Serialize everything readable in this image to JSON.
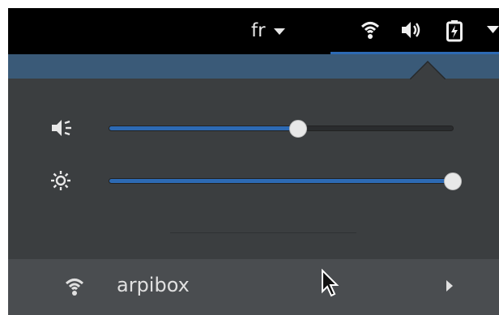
{
  "topbar": {
    "language": "fr",
    "icons": [
      "chevron-down-icon",
      "wifi-icon",
      "volume-icon",
      "battery-charging-icon",
      "chevron-down-icon"
    ]
  },
  "sliders": {
    "volume": {
      "icon": "volume-icon",
      "level": 0.55
    },
    "brightness": {
      "icon": "brightness-icon",
      "level": 1.0
    }
  },
  "network": {
    "icon": "wifi-icon",
    "name": "arpibox",
    "expand_icon": "chevron-right-icon"
  },
  "colors": {
    "accent": "#2d6ab4",
    "panel": "#3b3e40",
    "row": "#4a4d50"
  }
}
